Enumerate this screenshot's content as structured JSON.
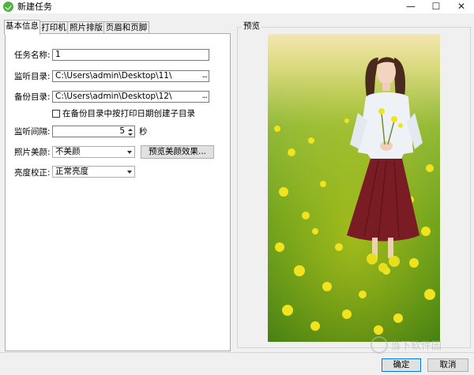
{
  "window": {
    "title": "新建任务",
    "minimize_glyph": "—",
    "maximize_glyph": "☐",
    "close_glyph": "✕"
  },
  "tabs": [
    {
      "label": "基本信息",
      "active": true
    },
    {
      "label": "打印机",
      "active": false
    },
    {
      "label": "照片排版",
      "active": false
    },
    {
      "label": "页眉和页脚",
      "active": false
    }
  ],
  "form": {
    "task_name_label": "任务名称:",
    "task_name_value": "1",
    "monitor_dir_label": "监听目录:",
    "monitor_dir_value": "C:\\Users\\admin\\Desktop\\11\\",
    "backup_dir_label": "备份目录:",
    "backup_dir_value": "C:\\Users\\admin\\Desktop\\12\\",
    "browse_label": "...",
    "subfolder_checkbox_label": "在备份目录中按打印日期创建子目录",
    "interval_label": "监听间隔:",
    "interval_value": "5",
    "interval_unit": "秒",
    "beauty_label": "照片美颜:",
    "beauty_value": "不美颜",
    "preview_beauty_button": "预览美颜效果...",
    "brightness_label": "亮度校正:",
    "brightness_value": "正常亮度"
  },
  "preview": {
    "label": "预览"
  },
  "footer": {
    "ok_label": "确定",
    "cancel_label": "取消"
  },
  "watermark": {
    "text": "当下软件园"
  },
  "colors": {
    "accent": "#0078d7",
    "app_icon": "#52b044"
  }
}
